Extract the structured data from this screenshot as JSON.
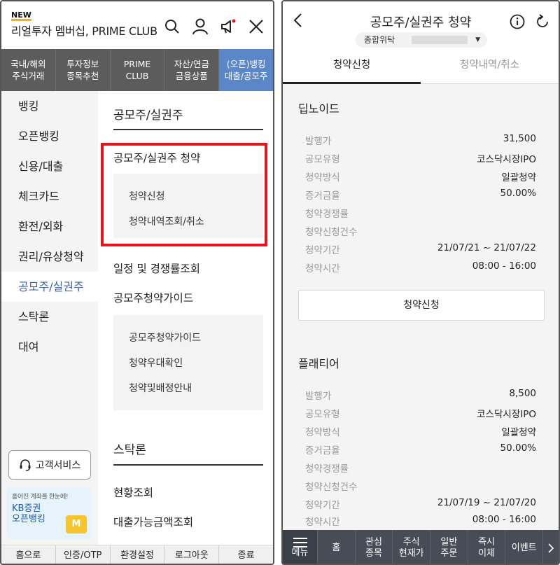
{
  "left": {
    "new_tag": "NEW",
    "brand": "리얼투자 멤버십, PRIME CLUB",
    "header_icons": [
      "search-icon",
      "user-icon",
      "megaphone-icon",
      "close-icon"
    ],
    "top_nav": [
      {
        "label": "국내/해외\n주식거래",
        "active": false
      },
      {
        "label": "투자정보\n종목추천",
        "active": false
      },
      {
        "label": "PRIME\nCLUB",
        "active": false
      },
      {
        "label": "자산/연금\n금융상품",
        "active": false
      },
      {
        "label": "(오픈)뱅킹\n대출/공모주",
        "active": true
      }
    ],
    "sidebar": [
      {
        "label": "뱅킹",
        "active": false
      },
      {
        "label": "오픈뱅킹",
        "active": false
      },
      {
        "label": "신용/대출",
        "active": false
      },
      {
        "label": "체크카드",
        "active": false
      },
      {
        "label": "환전/외화",
        "active": false
      },
      {
        "label": "권리/유상청약",
        "active": false
      },
      {
        "label": "공모주/실권주",
        "active": true
      },
      {
        "label": "스탁론",
        "active": false
      },
      {
        "label": "대여",
        "active": false
      }
    ],
    "customer_service": "고객서비스",
    "promo": {
      "line1": "흩어진 계좌를 한눈에!",
      "line2": "KB증권",
      "line3": "오픈뱅킹",
      "badge": "M"
    },
    "content": {
      "section1_title": "공모주/실권주",
      "subscription_title": "공모주/실권주 청약",
      "subscription_items": [
        "청약신청",
        "청약내역조회/취소"
      ],
      "schedule": "일정 및 경쟁률조회",
      "guide_title": "공모주청약가이드",
      "guide_items": [
        "공모주청약가이드",
        "청약우대확인",
        "청약및배정안내"
      ],
      "section2_title": "스탁론",
      "section2_items": [
        "현황조회",
        "대출가능금액조회"
      ]
    },
    "bottom_bar": [
      "홈으로",
      "인증/OTP",
      "환경설정",
      "로그아웃",
      "종료"
    ]
  },
  "right": {
    "title": "공모주/실권주 청약",
    "account_label": "종합위탁",
    "tabs": [
      {
        "label": "청약신청",
        "active": true
      },
      {
        "label": "청약내역/취소",
        "active": false
      }
    ],
    "stocks": [
      {
        "name": "딥노이드",
        "rows": [
          {
            "k": "발행가",
            "v": "31,500"
          },
          {
            "k": "공모유형",
            "v": "코스닥시장IPO"
          },
          {
            "k": "청약방식",
            "v": "일괄청약"
          },
          {
            "k": "증거금율",
            "v": "50.00%"
          },
          {
            "k": "청약경쟁률",
            "v": ""
          },
          {
            "k": "청약신청건수",
            "v": ""
          },
          {
            "k": "청약기간",
            "v": "21/07/21 ~ 21/07/22"
          },
          {
            "k": "청약시간",
            "v": "08:00 - 16:00"
          }
        ],
        "button": "청약신청"
      },
      {
        "name": "플래티어",
        "rows": [
          {
            "k": "발행가",
            "v": "8,500"
          },
          {
            "k": "공모유형",
            "v": "코스닥시장IPO"
          },
          {
            "k": "청약방식",
            "v": "일괄청약"
          },
          {
            "k": "증거금율",
            "v": "50.00%"
          },
          {
            "k": "청약경쟁률",
            "v": ""
          },
          {
            "k": "청약신청건수",
            "v": ""
          },
          {
            "k": "청약기간",
            "v": "21/07/19 ~ 21/07/20"
          },
          {
            "k": "청약시간",
            "v": "08:00 - 16:00"
          }
        ]
      }
    ],
    "bottom_nav": [
      {
        "label": "메뉴",
        "type": "menu"
      },
      {
        "label": "홈"
      },
      {
        "label": "관심\n종목"
      },
      {
        "label": "주식\n현재가"
      },
      {
        "label": "일반\n주문"
      },
      {
        "label": "즉시\n이체"
      },
      {
        "label": "이벤트"
      }
    ]
  }
}
